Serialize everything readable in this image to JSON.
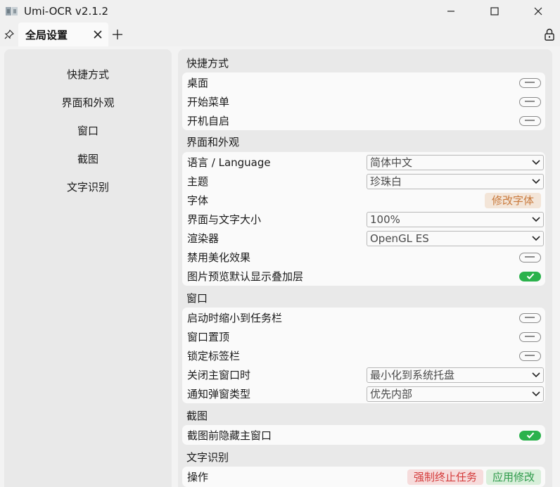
{
  "window": {
    "title": "Umi-OCR v2.1.2"
  },
  "tabs": [
    {
      "label": "全局设置"
    }
  ],
  "sidebar": {
    "items": [
      {
        "label": "快捷方式"
      },
      {
        "label": "界面和外观"
      },
      {
        "label": "窗口"
      },
      {
        "label": "截图"
      },
      {
        "label": "文字识别"
      }
    ]
  },
  "sections": {
    "shortcuts": {
      "title": "快捷方式",
      "rows": [
        {
          "label": "桌面",
          "switch": "off"
        },
        {
          "label": "开始菜单",
          "switch": "off"
        },
        {
          "label": "开机自启",
          "switch": "off"
        }
      ]
    },
    "appearance": {
      "title": "界面和外观",
      "rows": [
        {
          "label": "语言 / Language",
          "select": "简体中文"
        },
        {
          "label": "主题",
          "select": "珍珠白"
        },
        {
          "label": "字体",
          "button": "修改字体"
        },
        {
          "label": "界面与文字大小",
          "select": "100%"
        },
        {
          "label": "渲染器",
          "select": "OpenGL ES"
        },
        {
          "label": "禁用美化效果",
          "switch": "off"
        },
        {
          "label": "图片预览默认显示叠加层",
          "switch": "on"
        }
      ]
    },
    "window": {
      "title": "窗口",
      "rows": [
        {
          "label": "启动时缩小到任务栏",
          "switch": "off"
        },
        {
          "label": "窗口置顶",
          "switch": "off"
        },
        {
          "label": "锁定标签栏",
          "switch": "off"
        },
        {
          "label": "关闭主窗口时",
          "select": "最小化到系统托盘"
        },
        {
          "label": "通知弹窗类型",
          "select": "优先内部"
        }
      ]
    },
    "screenshot": {
      "title": "截图",
      "rows": [
        {
          "label": "截图前隐藏主窗口",
          "switch": "on"
        }
      ]
    },
    "ocr": {
      "title": "文字识别",
      "rows": [
        {
          "label": "操作",
          "buttons": [
            "强制终止任务",
            "应用修改"
          ]
        }
      ]
    }
  },
  "colors": {
    "accent_green": "#2bb24c",
    "stop_red": "#d43a3a",
    "font_orange": "#c97a3d"
  }
}
